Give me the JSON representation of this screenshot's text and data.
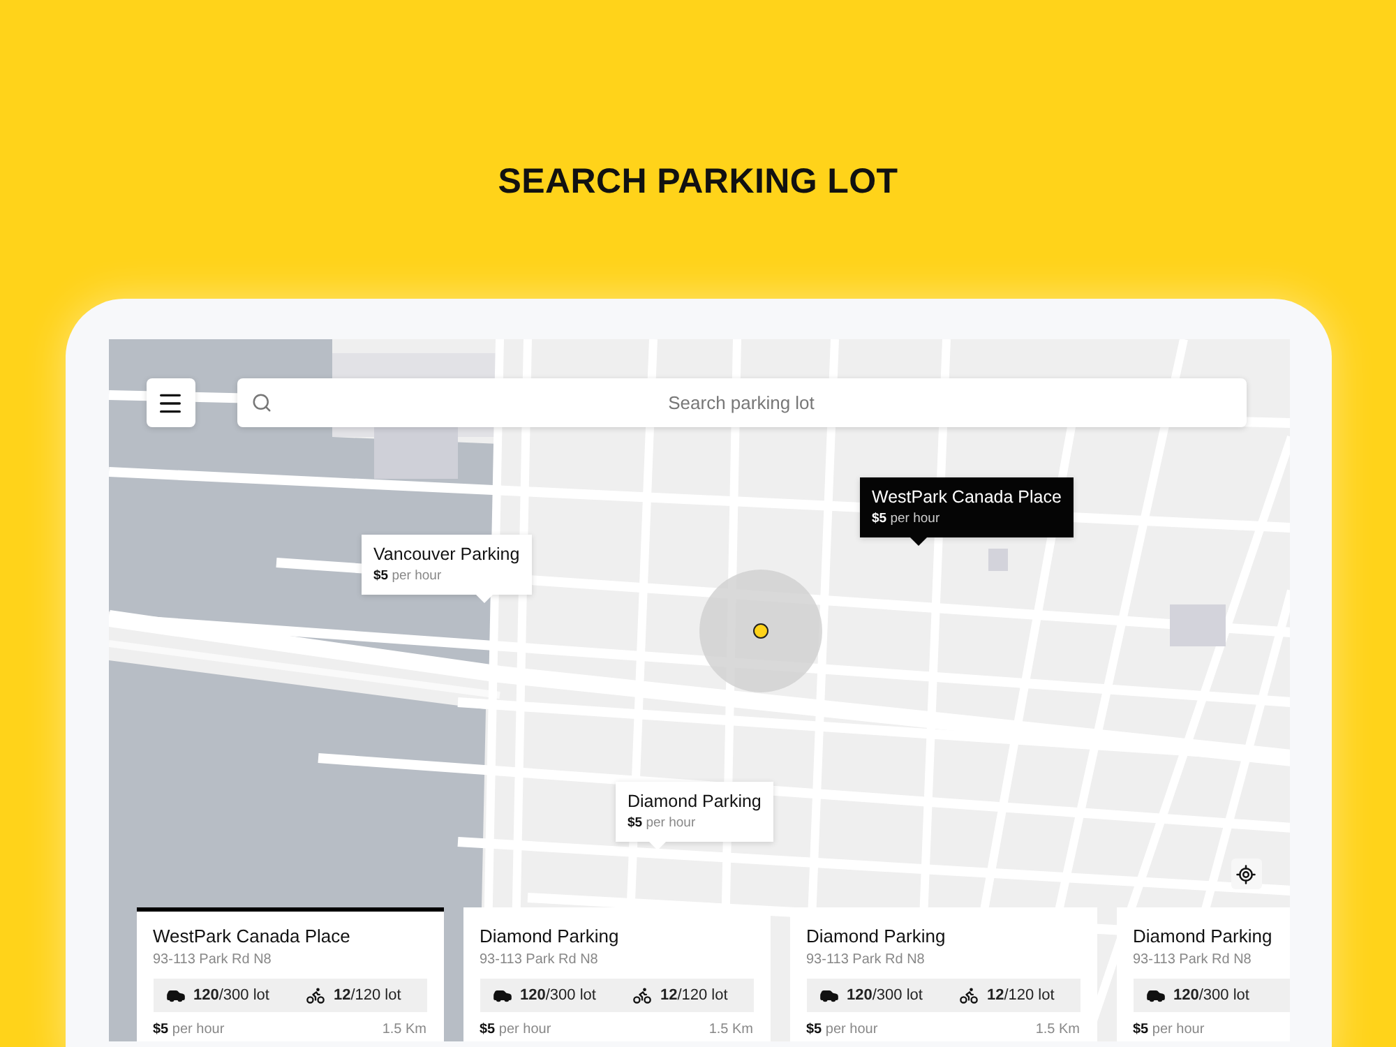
{
  "heading": "SEARCH PARKING LOT",
  "search": {
    "placeholder": "Search parking lot"
  },
  "markers": [
    {
      "name": "Vancouver Parking",
      "price": "$5",
      "unit": "per hour",
      "selected": false
    },
    {
      "name": "WestPark Canada Place",
      "price": "$5",
      "unit": "per hour",
      "selected": true
    },
    {
      "name": "Diamond Parking",
      "price": "$5",
      "unit": "per hour",
      "selected": false
    }
  ],
  "cards": [
    {
      "name": "WestPark Canada Place",
      "address": "93-113 Park Rd N8",
      "cars_free": "120",
      "cars_total": "/300 lot",
      "bikes_free": "12",
      "bikes_total": "/120 lot",
      "price": "$5",
      "unit": "per hour",
      "distance": "1.5 Km",
      "selected": true
    },
    {
      "name": "Diamond Parking",
      "address": "93-113 Park Rd N8",
      "cars_free": "120",
      "cars_total": "/300 lot",
      "bikes_free": "12",
      "bikes_total": "/120 lot",
      "price": "$5",
      "unit": "per hour",
      "distance": "1.5 Km",
      "selected": false
    },
    {
      "name": "Diamond Parking",
      "address": "93-113 Park Rd N8",
      "cars_free": "120",
      "cars_total": "/300 lot",
      "bikes_free": "12",
      "bikes_total": "/120 lot",
      "price": "$5",
      "unit": "per hour",
      "distance": "1.5 Km",
      "selected": false
    },
    {
      "name": "Diamond Parking",
      "address": "93-113 Park Rd N8",
      "cars_free": "120",
      "cars_total": "/300 lot",
      "price": "$5",
      "unit": "per hour",
      "selected": false
    }
  ]
}
